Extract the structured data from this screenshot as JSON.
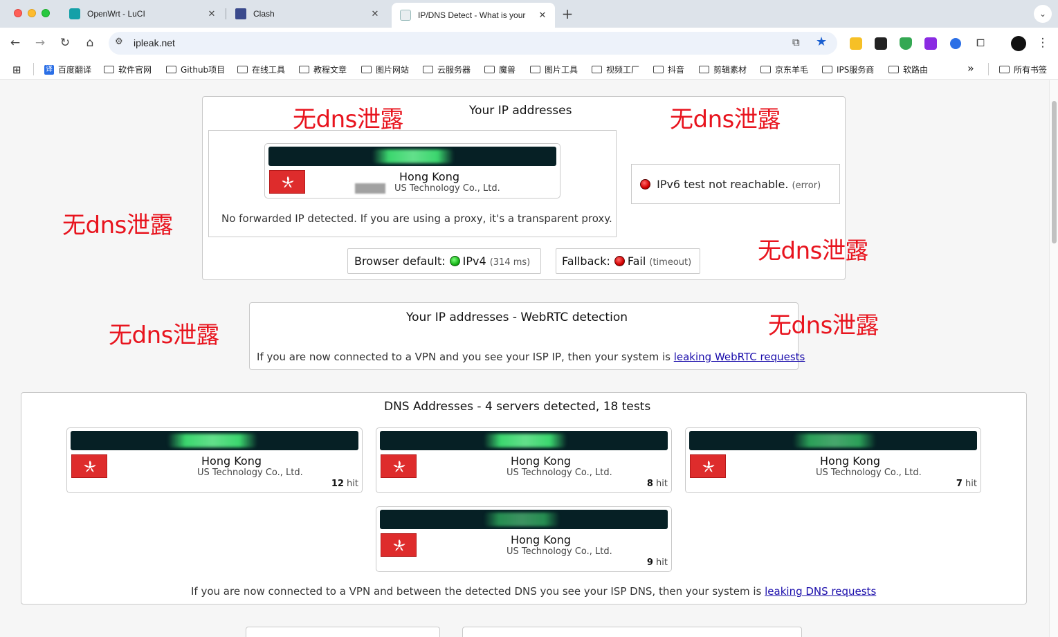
{
  "browser": {
    "tabs": [
      {
        "title": "OpenWrt - LuCI",
        "active": false
      },
      {
        "title": "Clash",
        "active": false
      },
      {
        "title": "IP/DNS Detect - What is your",
        "active": true
      }
    ],
    "url": "ipleak.net",
    "bookmarks": [
      "百度翻译",
      "软件官网",
      "Github项目",
      "在线工具",
      "教程文章",
      "图片网站",
      "云服务器",
      "魔兽",
      "图片工具",
      "视频工厂",
      "抖音",
      "剪辑素材",
      "京东羊毛",
      "IPS服务商",
      "软路由"
    ],
    "all_bookmarks": "所有书签",
    "more_label": "»"
  },
  "ip_section": {
    "title": "Your IP addresses",
    "card": {
      "city": "Hong Kong",
      "isp": "US Technology Co., Ltd."
    },
    "no_forward": "No forwarded IP detected. If you are using a proxy, it's a transparent proxy.",
    "ipv6": {
      "text": "IPv6 test not reachable.",
      "status": "(error)"
    },
    "browser_default": {
      "label": "Browser default:",
      "proto": "IPv4",
      "latency": "(314 ms)"
    },
    "fallback": {
      "label": "Fallback:",
      "result": "Fail",
      "reason": "(timeout)"
    }
  },
  "webrtc": {
    "title": "Your IP addresses - WebRTC detection",
    "note": "If you are now connected to a VPN and you see your ISP IP, then your system is",
    "link": "leaking WebRTC requests"
  },
  "dns": {
    "title": "DNS Addresses - 4 servers detected, 18 tests",
    "servers": [
      {
        "city": "Hong Kong",
        "isp": "US Technology Co., Ltd.",
        "hits": "12",
        "hit_label": "hit"
      },
      {
        "city": "Hong Kong",
        "isp": "US Technology Co., Ltd.",
        "hits": "8",
        "hit_label": "hit"
      },
      {
        "city": "Hong Kong",
        "isp": "US Technology Co., Ltd.",
        "hits": "7",
        "hit_label": "hit"
      },
      {
        "city": "Hong Kong",
        "isp": "US Technology Co., Ltd.",
        "hits": "9",
        "hit_label": "hit"
      }
    ],
    "note": "If you are now connected to a VPN and between the detected DNS you see your ISP DNS, then your system is",
    "link": "leaking DNS requests"
  },
  "annotation": "无dns泄露",
  "colors": {
    "annotation": "#e8141e",
    "link": "#1a0dab",
    "ipbar": "#062025",
    "flag": "#de2c2c"
  }
}
